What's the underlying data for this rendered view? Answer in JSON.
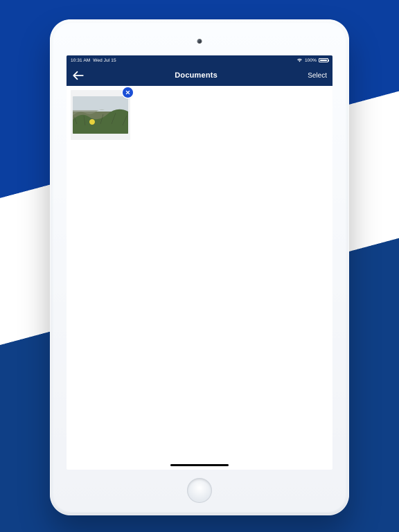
{
  "status": {
    "time": "10:31 AM",
    "date": "Wed Jul 15",
    "battery_pct": "100%"
  },
  "nav": {
    "title": "Documents",
    "select_label": "Select"
  },
  "grid": {
    "items": [
      {
        "label": ""
      }
    ]
  }
}
